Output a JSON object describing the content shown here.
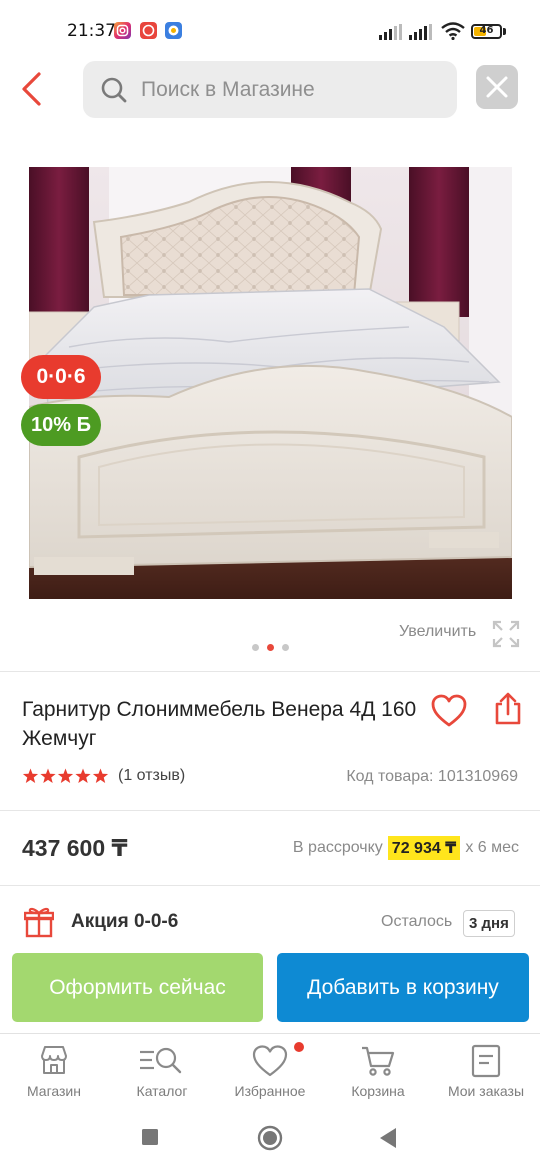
{
  "status_bar": {
    "time": "21:37",
    "battery": "46",
    "battery_level": 0.46,
    "icons": [
      "instagram-icon",
      "app-icon",
      "app-icon",
      "signal-icon",
      "signal-icon",
      "wifi-icon",
      "battery-icon"
    ]
  },
  "header": {
    "search_placeholder": "Поиск в Магазине",
    "back_icon": "chevron-left-icon",
    "close_icon": "close-icon"
  },
  "product": {
    "badge_installment": "0·0·6",
    "badge_bonus": "10% Б",
    "zoom_label": "Увеличить",
    "gallery_total": 3,
    "gallery_active": 2,
    "title": "Гарнитур Слониммебель Венера 4Д 160 Жемчуг",
    "rating": 5,
    "reviews": "(1 отзыв)",
    "sku": "Код товара: 101310969",
    "price": "437 600 ₸",
    "installment_prefix": "В рассрочку",
    "installment_amount": "72 934 ₸",
    "installment_suffix": "х 6 мес"
  },
  "promo": {
    "label": "Акция 0-0-6",
    "remaining_label": "Осталось",
    "days": "3 дня"
  },
  "actions": {
    "buy_now": "Оформить сейчас",
    "add_to_cart": "Добавить в корзину"
  },
  "tabbar": {
    "items": [
      {
        "label": "Магазин",
        "icon": "store-icon"
      },
      {
        "label": "Каталог",
        "icon": "catalog-search-icon"
      },
      {
        "label": "Избранное",
        "icon": "heart-icon",
        "has_dot": true
      },
      {
        "label": "Корзина",
        "icon": "cart-icon"
      },
      {
        "label": "Мои заказы",
        "icon": "orders-icon"
      }
    ]
  },
  "colors": {
    "accent_red": "#e83b2e",
    "buy_button": "#a3d86f",
    "cart_button": "#0e8ad3",
    "bonus_green": "#4d9b22",
    "installment_highlight": "#ffe51c"
  }
}
